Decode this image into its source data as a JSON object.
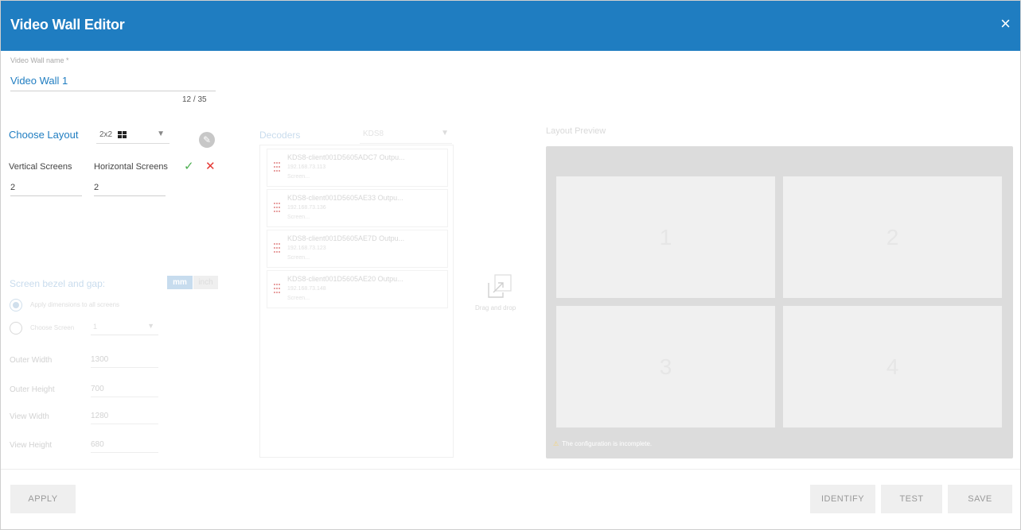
{
  "dialog": {
    "title": "Video Wall Editor",
    "close_glyph": "×"
  },
  "name_field": {
    "label": "Video Wall name *",
    "value": "Video Wall 1",
    "counter": "12 / 35"
  },
  "layout": {
    "label": "Choose Layout",
    "selected": "2x2",
    "icon": "grid-2x2-icon"
  },
  "screens": {
    "vertical_label": "Vertical Screens",
    "horizontal_label": "Horizontal Screens",
    "vertical_value": "2",
    "horizontal_value": "2"
  },
  "bezel": {
    "title": "Screen bezel and gap:",
    "unit_mm": "mm",
    "unit_inch": "inch",
    "apply_all_label": "Apply dimensions to all screens",
    "choose_screen_label": "Choose Screen",
    "choose_screen_value": "1",
    "outer_width_label": "Outer Width",
    "outer_width_value": "1300",
    "outer_height_label": "Outer Height",
    "outer_height_value": "700",
    "view_width_label": "View Width",
    "view_width_value": "1280",
    "view_height_label": "View Height",
    "view_height_value": "680"
  },
  "decoders": {
    "title": "Decoders",
    "filter_value": "KDS8",
    "items": [
      {
        "name": "KDS8-client001D5605ADC7 Outpu...",
        "ip": "192.168.73.113",
        "screen": "Screen..."
      },
      {
        "name": "KDS8-client001D5605AE33 Outpu...",
        "ip": "192.168.73.136",
        "screen": "Screen..."
      },
      {
        "name": "KDS8-client001D5605AE7D Outpu...",
        "ip": "192.168.73.123",
        "screen": "Screen..."
      },
      {
        "name": "KDS8-client001D5605AE20 Outpu...",
        "ip": "192.168.73.148",
        "screen": "Screen..."
      }
    ]
  },
  "drag_drop": {
    "label": "Drag and drop"
  },
  "preview": {
    "title": "Layout Preview",
    "cells": [
      "1",
      "2",
      "3",
      "4"
    ],
    "warning": "The configuration is incomplete."
  },
  "footer": {
    "apply": "APPLY",
    "identify": "IDENTIFY",
    "test": "TEST",
    "save": "SAVE"
  },
  "colors": {
    "header": "#1f7dc1",
    "accent": "#1f7dc1",
    "check": "#4caf50",
    "cross": "#e53935",
    "preview_bg": "#dcdcdc"
  }
}
